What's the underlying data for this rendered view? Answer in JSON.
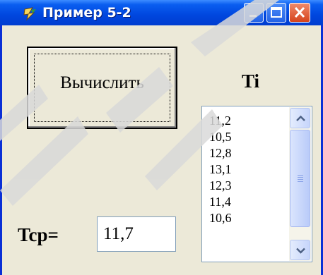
{
  "window": {
    "title": "Пример 5-2",
    "accent_color": "#0046de",
    "close_color": "#d5431c"
  },
  "controls": {
    "calc_button_label": "Вычислить",
    "ti_label": "Ti",
    "tcp_label": "Tcp=",
    "tcp_value": "11,7"
  },
  "listbox": {
    "items": [
      "11,2",
      "10,5",
      "12,8",
      "13,1",
      "12,3",
      "11,4",
      "10,6"
    ]
  },
  "icons": {
    "app": "delphi-app-icon",
    "minimize": "minimize-icon",
    "maximize": "maximize-icon",
    "close": "close-icon",
    "scroll_up": "chevron-up-icon",
    "scroll_down": "chevron-down-icon"
  }
}
